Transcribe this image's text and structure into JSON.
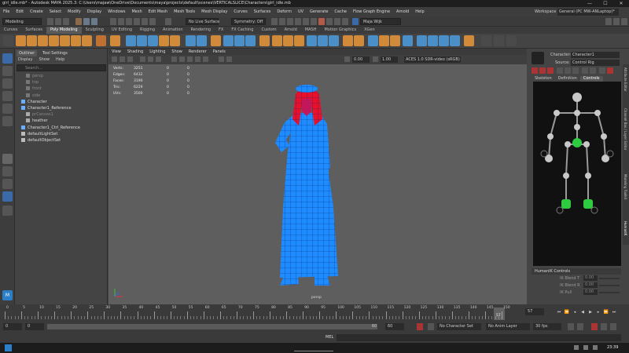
{
  "window": {
    "title": "girl_idle.mb* - Autodesk MAYA 2025.3: C:\\Users\\majaw\\OneDrive\\Documents\\maya\\projects\\default\\scenes\\VERTICALSLICE\\Characters\\girl_idle.mb",
    "minimize": "—",
    "maximize": "☐",
    "close": "✕"
  },
  "menubar": {
    "items": [
      "File",
      "Edit",
      "Create",
      "Select",
      "Modify",
      "Display",
      "Windows",
      "Mesh",
      "Edit Mesh",
      "Mesh Tools",
      "Mesh Display",
      "Curves",
      "Surfaces",
      "Deform",
      "UV",
      "Generate",
      "Cache",
      "Flow Graph Engine",
      "Arnold",
      "Help"
    ],
    "workspace_label": "Workspace :",
    "workspace_value": "General (PC MW-ANLaptop)*"
  },
  "statusline": {
    "mode": "Modeling",
    "live_surface": "No Live Surface",
    "symmetry": "Symmetry: Off",
    "user": "Maja Wijk"
  },
  "shelf_tabs": [
    "Curves",
    "Surfaces",
    "Poly Modeling",
    "Sculpting",
    "UV Editing",
    "Rigging",
    "Animation",
    "Rendering",
    "FX",
    "FX Caching",
    "Custom",
    "Arnold",
    "MASH",
    "Motion Graphics",
    "XGen"
  ],
  "shelf_active": "Poly Modeling",
  "outliner": {
    "tabs": [
      "Outliner",
      "Tool Settings"
    ],
    "menu": [
      "Display",
      "Show",
      "Help"
    ],
    "search_placeholder": "Search...",
    "items": [
      "persp",
      "top",
      "front",
      "side",
      "Character",
      "Character1_Reference",
      "prCanvas1",
      "heather",
      "Character1_Ctrl_Reference",
      "defaultLightSet",
      "defaultObjectSet"
    ]
  },
  "viewport": {
    "menu": [
      "View",
      "Shading",
      "Lighting",
      "Show",
      "Renderer",
      "Panels"
    ],
    "field_a": "0.00",
    "field_b": "1.00",
    "colorspace": "ACES 1.0 SDR-video (sRGB)",
    "camera_label": "persp",
    "hud": [
      {
        "label": "Verts:",
        "v1": "3251",
        "v2": "0",
        "v3": "0"
      },
      {
        "label": "Edges:",
        "v1": "6432",
        "v2": "0",
        "v3": "0"
      },
      {
        "label": "Faces:",
        "v1": "3190",
        "v2": "0",
        "v3": "0"
      },
      {
        "label": "Tris:",
        "v1": "6229",
        "v2": "0",
        "v3": "0"
      },
      {
        "label": "UVs:",
        "v1": "3500",
        "v2": "0",
        "v3": "0"
      }
    ]
  },
  "character_controls": {
    "character_label": "Character:",
    "character_value": "Character1",
    "source_label": "Source:",
    "source_value": "Control Rig",
    "tabs": [
      "Skeleton",
      "Definition",
      "Controls"
    ],
    "section": "HumanIK Controls",
    "blend_rows": [
      {
        "label": "IK Blend T",
        "value": "0.00"
      },
      {
        "label": "IK Blend R",
        "value": "0.00"
      },
      {
        "label": "IK Pull",
        "value": "0.00"
      }
    ],
    "side_tabs": [
      "Attribute Editor",
      "Channel Box / Layer Editor",
      "Modeling Toolkit",
      "HumanIK"
    ]
  },
  "timeline": {
    "ticks": [
      "0",
      "5",
      "10",
      "15",
      "20",
      "25",
      "30",
      "35",
      "40",
      "45",
      "50",
      "55",
      "60",
      "65",
      "70",
      "75",
      "80",
      "85",
      "90",
      "95",
      "100",
      "105",
      "110",
      "115",
      "120",
      "125",
      "130",
      "135",
      "140",
      "145",
      "150"
    ],
    "current_frame": "57",
    "current_frame_field": "57"
  },
  "range": {
    "start": "0",
    "inner_start": "0",
    "inner_end": "60",
    "end": "60",
    "char_set": "No Character Set",
    "anim_layer": "No Anim Layer",
    "fps": "30 fps"
  },
  "cmdline": {
    "label": "MEL"
  },
  "taskbar": {
    "clock": "23:39"
  }
}
